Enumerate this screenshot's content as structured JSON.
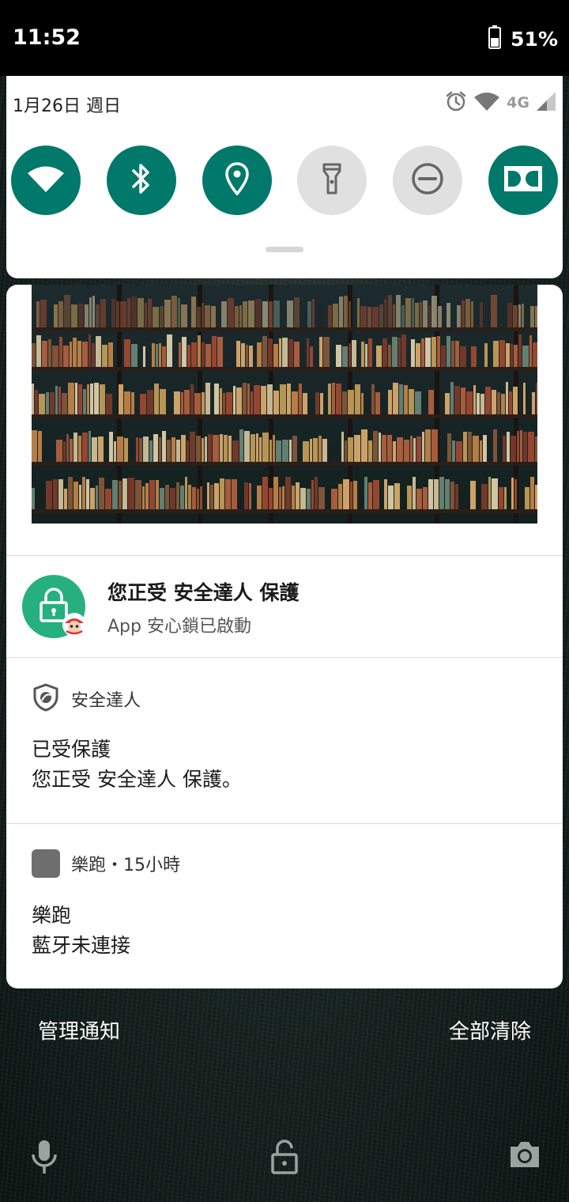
{
  "status_bar": {
    "time": "11:52",
    "battery_percent": "51%",
    "battery_level": 0.51,
    "icons": [
      "battery-icon"
    ]
  },
  "quick_settings": {
    "date": "1月26日 週日",
    "status_icons": [
      "alarm-icon",
      "wifi-signal-icon",
      "mobile-signal-icon"
    ],
    "network_type": "4G",
    "tiles": [
      {
        "name": "wifi",
        "icon": "wifi-icon",
        "state": "on"
      },
      {
        "name": "bluetooth",
        "icon": "bluetooth-icon",
        "state": "on"
      },
      {
        "name": "location",
        "icon": "location-icon",
        "state": "on"
      },
      {
        "name": "flashlight",
        "icon": "flashlight-icon",
        "state": "off"
      },
      {
        "name": "do-not-disturb",
        "icon": "dnd-icon",
        "state": "off"
      },
      {
        "name": "dolby",
        "icon": "dolby-icon",
        "state": "on"
      }
    ],
    "accent_color": "#00796b",
    "off_color": "#e0e0e0"
  },
  "notifications": {
    "app_lock": {
      "title": "您正受 安全達人 保護",
      "subtitle": "App 安心鎖已啟動",
      "icon": "lock-icon",
      "icon_color": "#26b07f"
    },
    "security": {
      "app_name": "安全達人",
      "app_icon": "shield-icon",
      "title": "已受保護",
      "body": "您正受 安全達人 保護。"
    },
    "running": {
      "app_name": "樂跑",
      "time_ago": "15小時",
      "header": "樂跑・15小時",
      "title": "樂跑",
      "body": "藍牙未連接"
    }
  },
  "footer": {
    "manage_label": "管理通知",
    "clear_all_label": "全部清除"
  },
  "lock_screen": {
    "icons": [
      "microphone-icon",
      "unlock-icon",
      "camera-icon"
    ]
  }
}
